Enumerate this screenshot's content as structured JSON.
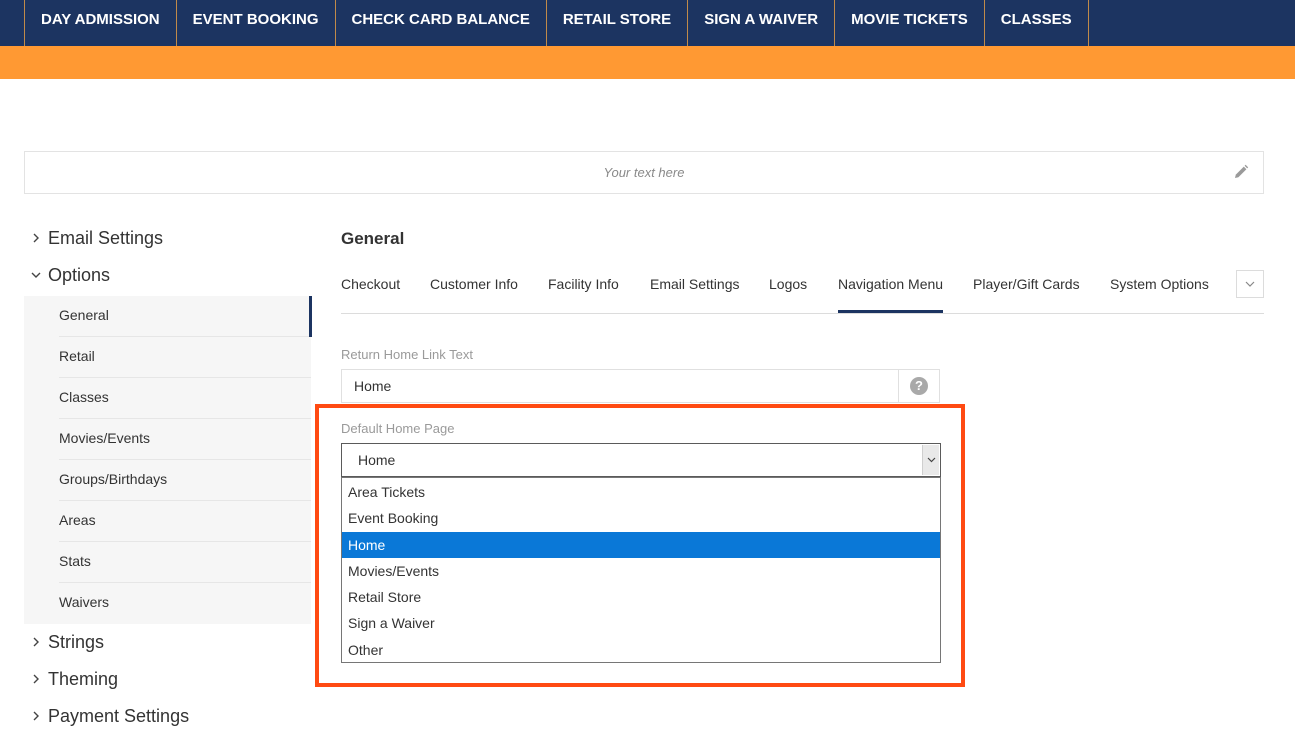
{
  "topnav": {
    "items": [
      {
        "label": "DAY ADMISSION"
      },
      {
        "label": "EVENT BOOKING"
      },
      {
        "label": "CHECK CARD BALANCE"
      },
      {
        "label": "RETAIL STORE"
      },
      {
        "label": "SIGN A WAIVER"
      },
      {
        "label": "MOVIE TICKETS"
      },
      {
        "label": "CLASSES"
      }
    ]
  },
  "banner": {
    "placeholder": "Your text here",
    "edit_icon": "pencil-icon"
  },
  "sidebar": {
    "email_settings": "Email Settings",
    "options": "Options",
    "options_items": [
      "General",
      "Retail",
      "Classes",
      "Movies/Events",
      "Groups/Birthdays",
      "Areas",
      "Stats",
      "Waivers"
    ],
    "active_item": "General",
    "strings": "Strings",
    "theming": "Theming",
    "payment_settings": "Payment Settings"
  },
  "main": {
    "title": "General",
    "tabs": [
      "Checkout",
      "Customer Info",
      "Facility Info",
      "Email Settings",
      "Logos",
      "Navigation Menu",
      "Player/Gift Cards",
      "System Options"
    ],
    "active_tab": "Navigation Menu",
    "return_home": {
      "label": "Return Home Link Text",
      "value": "Home",
      "help": "?"
    },
    "default_home": {
      "label": "Default Home Page",
      "value": "Home",
      "options": [
        "Area Tickets",
        "Event Booking",
        "Home",
        "Movies/Events",
        "Retail Store",
        "Sign a Waiver",
        "Other"
      ]
    }
  },
  "colors": {
    "nav_bg": "#1c3461",
    "accent_orange": "#ff9933",
    "highlight": "#ff4a12",
    "selected_option": "#0a78d7"
  }
}
